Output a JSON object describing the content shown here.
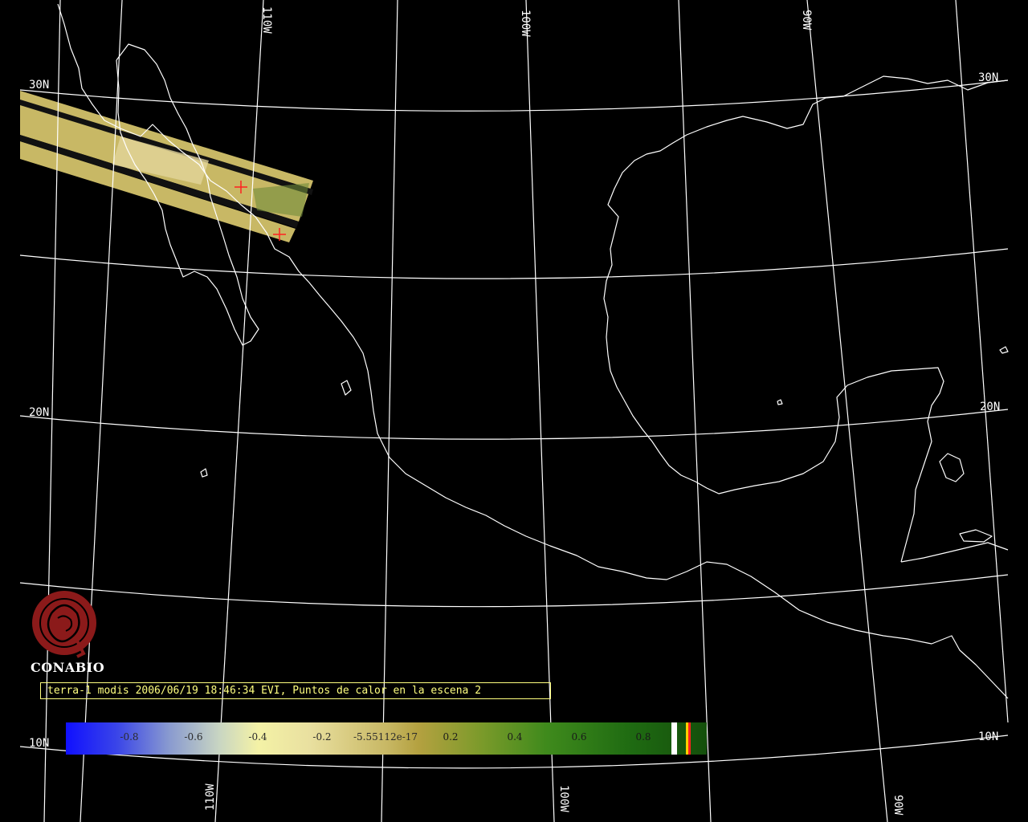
{
  "map": {
    "longitude_labels": [
      "110W",
      "100W",
      "90W"
    ],
    "latitude_labels": [
      "30N",
      "20N",
      "10N"
    ],
    "colors": {
      "background": "#000000",
      "grid": "#ffffff",
      "coastline": "#ffffff",
      "swath": "#c8b865",
      "hotspot_marker": "#ff2020"
    },
    "hotspot_count": 2
  },
  "logo": {
    "icon": "conabio-emblem-icon",
    "text": "CONABIO",
    "color": "#8b1a1a"
  },
  "caption": "terra-1 modis 2006/06/19 18:46:34 EVI, Puntos de calor en la escena 2",
  "colorbar": {
    "ticks": [
      "-0.8",
      "-0.6",
      "-0.4",
      "-0.2",
      "-5.55112e-17",
      "0.2",
      "0.4",
      "0.6",
      "0.8"
    ],
    "colors": [
      "#1010ff",
      "#8899d0",
      "#f4f2a6",
      "#c8b865",
      "#3f8a1c",
      "#144f0b"
    ],
    "special_swatches": [
      "#ffffff",
      "#ffd000",
      "#ff2020"
    ]
  }
}
